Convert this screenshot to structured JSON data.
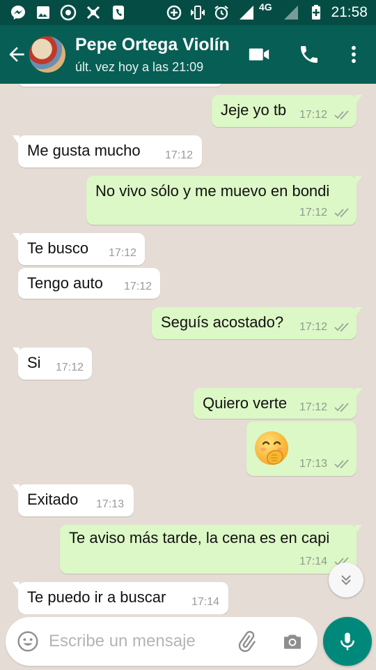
{
  "status_bar": {
    "network": "4G",
    "time": "21:58",
    "icons": [
      "messenger-icon",
      "gallery-icon",
      "chrome-icon",
      "clean-master-icon",
      "phone-app-icon",
      "data-saver-icon",
      "vibrate-icon",
      "alarm-icon",
      "signal-icon",
      "battery-charging-icon"
    ]
  },
  "header": {
    "contact_name": "Pepe Ortega Violín",
    "last_seen": "últ. vez hoy a las 21:09",
    "actions": [
      "video-call-icon",
      "voice-call-icon",
      "more-options-icon"
    ]
  },
  "messages": [
    {
      "dir": "out",
      "text": "Jeje yo tb",
      "time": "17:12",
      "read": true
    },
    {
      "dir": "in",
      "text": "Me gusta mucho",
      "time": "17:12"
    },
    {
      "dir": "out",
      "text": "No vivo sólo y me muevo en bondi",
      "time": "17:12",
      "read": true
    },
    {
      "dir": "in",
      "text": "Te busco",
      "time": "17:12"
    },
    {
      "dir": "in",
      "text": "Tengo auto",
      "time": "17:12"
    },
    {
      "dir": "out",
      "text": "Seguís acostado?",
      "time": "17:12",
      "read": true
    },
    {
      "dir": "in",
      "text": "Si",
      "time": "17:12"
    },
    {
      "dir": "out",
      "text": "Quiero verte",
      "time": "17:12",
      "read": true
    },
    {
      "dir": "out",
      "emoji": "hand-over-mouth-emoji",
      "time": "17:13",
      "read": true
    },
    {
      "dir": "in",
      "text": "Exitado",
      "time": "17:13"
    },
    {
      "dir": "out",
      "text": "Te aviso más tarde, la cena es en capi",
      "time": "17:14",
      "read": true
    },
    {
      "dir": "in",
      "text": "Te puedo ir a buscar",
      "time": "17:14"
    }
  ],
  "composer": {
    "placeholder": "Escribe un mensaje",
    "icons": [
      "emoji-icon",
      "attach-icon",
      "camera-icon",
      "mic-icon"
    ]
  },
  "colors": {
    "status_bar": "#054d44",
    "app_bar": "#075e54",
    "chat_background": "#e5ddd5",
    "outgoing_bubble": "#dcf8c6",
    "incoming_bubble": "#ffffff",
    "mic_button": "#00897b"
  }
}
